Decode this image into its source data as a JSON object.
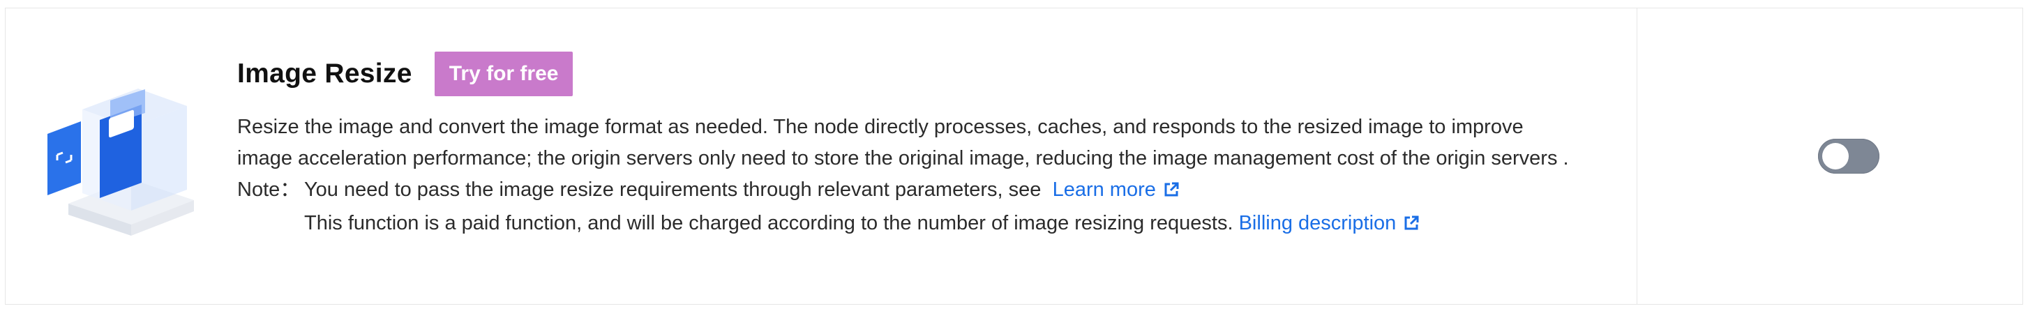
{
  "feature": {
    "title": "Image Resize",
    "badge": "Try for free",
    "description": "Resize the image and convert the image format as needed. The node directly processes, caches, and responds to the resized image to improve image acceleration performance; the origin servers only need to store the original image, reducing the image management cost of the origin servers .",
    "note_label": "Note：",
    "note_line1_text": "You need to pass the image resize requirements through relevant parameters, see",
    "note_line1_link": "Learn more",
    "note_line2_text": "This function is a paid function, and will be charged according to the number of image resizing requests.",
    "note_line2_link": "Billing description"
  },
  "toggle": {
    "enabled": false
  },
  "icons": {
    "illustration": "image-resize-illustration",
    "external": "external-link-icon"
  },
  "colors": {
    "badge": "#c97acb",
    "link": "#1a6ee6",
    "toggle_off": "#7e8795",
    "illustration_blue": "#1f6fe8"
  }
}
